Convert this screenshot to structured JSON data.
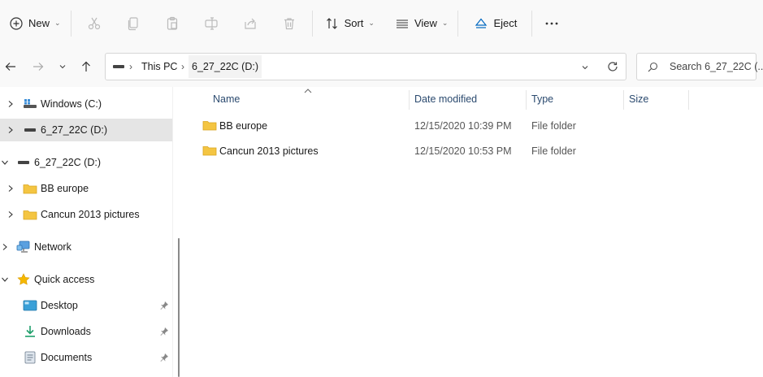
{
  "toolbar": {
    "new_label": "New",
    "sort_label": "Sort",
    "view_label": "View",
    "eject_label": "Eject"
  },
  "address": {
    "crumbs": [
      "This PC",
      "6_27_22C (D:)"
    ],
    "search_placeholder": "Search 6_27_22C (..."
  },
  "navpane": {
    "items": [
      {
        "label": "Windows (C:)",
        "icon": "drive-c-icon"
      },
      {
        "label": "6_27_22C (D:)",
        "icon": "drive-icon",
        "selected": true
      },
      {
        "label": "6_27_22C (D:)",
        "icon": "drive-icon",
        "expanded": true
      },
      {
        "label": "BB europe",
        "icon": "folder-icon"
      },
      {
        "label": "Cancun 2013 pictures",
        "icon": "folder-icon"
      },
      {
        "label": "Network",
        "icon": "network-icon"
      },
      {
        "label": "Quick access",
        "icon": "star-icon",
        "expanded": true
      },
      {
        "label": "Desktop",
        "icon": "desktop-icon",
        "pinned": true
      },
      {
        "label": "Downloads",
        "icon": "download-icon",
        "pinned": true
      },
      {
        "label": "Documents",
        "icon": "documents-icon",
        "pinned": true
      }
    ]
  },
  "content": {
    "columns": [
      "Name",
      "Date modified",
      "Type",
      "Size"
    ],
    "rows": [
      {
        "name": "BB europe",
        "date": "12/15/2020 10:39 PM",
        "type": "File folder",
        "size": ""
      },
      {
        "name": "Cancun 2013 pictures",
        "date": "12/15/2020 10:53 PM",
        "type": "File folder",
        "size": ""
      }
    ]
  },
  "colors": {
    "toolbar_bg": "#f9f9f9",
    "selection_bg": "#e5e5e5",
    "folder_yellow": "#f4c542",
    "accent_blue": "#0067c0"
  }
}
